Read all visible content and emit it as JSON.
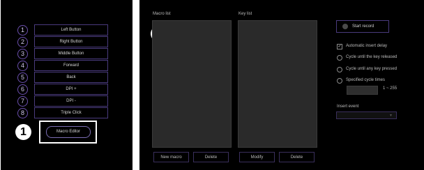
{
  "button_list": [
    {
      "num": "1",
      "label": "Left Button"
    },
    {
      "num": "2",
      "label": "Right Button"
    },
    {
      "num": "3",
      "label": "Middle Button"
    },
    {
      "num": "4",
      "label": "Forward"
    },
    {
      "num": "5",
      "label": "Back"
    },
    {
      "num": "6",
      "label": "DPI +"
    },
    {
      "num": "7",
      "label": "DPI -"
    },
    {
      "num": "8",
      "label": "Triple Click"
    }
  ],
  "macro_editor_label": "Macro Editor",
  "badges": {
    "one": "1",
    "two": "2"
  },
  "lists": {
    "macro_list_label": "Macro list",
    "key_list_label": "Key list"
  },
  "buttons": {
    "new_macro": "New macro",
    "delete_macro": "Delete",
    "modify": "Modify",
    "delete_key": "Delete"
  },
  "record": {
    "start_label": "Start record"
  },
  "options": {
    "auto_delay": "Automatic insert delay",
    "cycle_released": "Cycle until the key released",
    "cycle_pressed": "Cycle until any key pressed",
    "specified_times": "Specified cycle times",
    "range": "1 ~ 255"
  },
  "insert_event": {
    "label": "Insert event"
  }
}
